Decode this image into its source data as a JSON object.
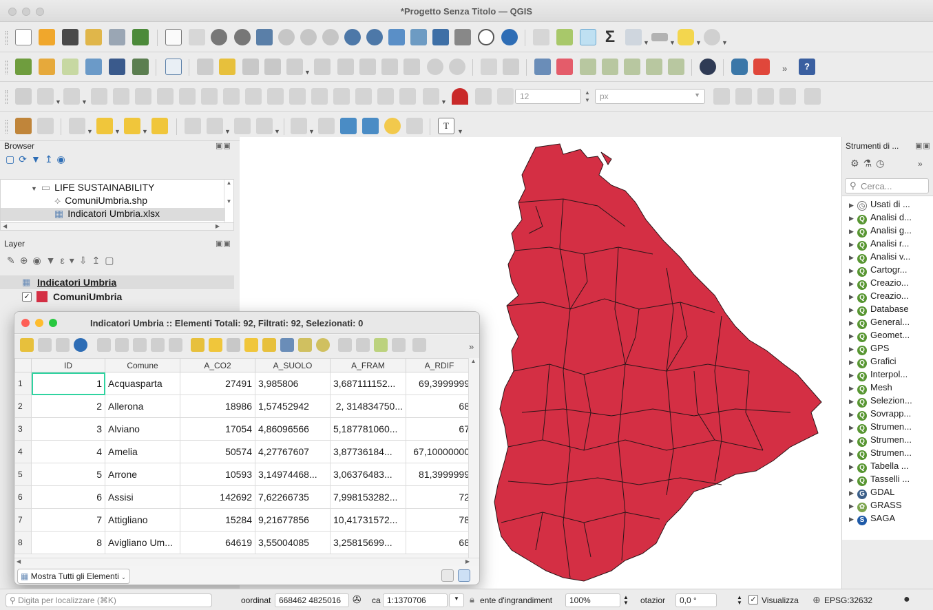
{
  "window": {
    "title": "*Progetto Senza Titolo — QGIS"
  },
  "browser": {
    "header": "Browser",
    "items": [
      {
        "label": "LIFE SUSTAINABILITY"
      },
      {
        "label": "ComuniUmbria.shp"
      },
      {
        "label": "Indicatori Umbria.xlsx"
      }
    ]
  },
  "layers": {
    "header": "Layer",
    "items": [
      {
        "label": "Indicatori Umbria",
        "checked": false
      },
      {
        "label": "ComuniUmbria",
        "checked": true,
        "color": "#d42f44"
      }
    ]
  },
  "processing": {
    "header": "Strumenti di ...",
    "search_placeholder": "Cerca...",
    "items": [
      {
        "label": "Usati di ...",
        "icon": "clock-icon"
      },
      {
        "label": "Analisi d...",
        "icon": "qgis-icon"
      },
      {
        "label": "Analisi g...",
        "icon": "qgis-icon"
      },
      {
        "label": "Analisi r...",
        "icon": "qgis-icon"
      },
      {
        "label": "Analisi v...",
        "icon": "qgis-icon"
      },
      {
        "label": "Cartogr...",
        "icon": "qgis-icon"
      },
      {
        "label": "Creazio...",
        "icon": "qgis-icon"
      },
      {
        "label": "Creazio...",
        "icon": "qgis-icon"
      },
      {
        "label": "Database",
        "icon": "qgis-icon"
      },
      {
        "label": "General...",
        "icon": "qgis-icon"
      },
      {
        "label": "Geomet...",
        "icon": "qgis-icon"
      },
      {
        "label": "GPS",
        "icon": "qgis-icon"
      },
      {
        "label": "Grafici",
        "icon": "qgis-icon"
      },
      {
        "label": "Interpol...",
        "icon": "qgis-icon"
      },
      {
        "label": "Mesh",
        "icon": "qgis-icon"
      },
      {
        "label": "Selezion...",
        "icon": "qgis-icon"
      },
      {
        "label": "Sovrapp...",
        "icon": "qgis-icon"
      },
      {
        "label": "Strumen...",
        "icon": "qgis-icon"
      },
      {
        "label": "Strumen...",
        "icon": "qgis-icon"
      },
      {
        "label": "Strumen...",
        "icon": "qgis-icon"
      },
      {
        "label": "Tabella ...",
        "icon": "qgis-icon"
      },
      {
        "label": "Tasselli ...",
        "icon": "qgis-icon"
      },
      {
        "label": "GDAL",
        "icon": "gdal-icon"
      },
      {
        "label": "GRASS",
        "icon": "grass-icon"
      },
      {
        "label": "SAGA",
        "icon": "saga-icon"
      }
    ]
  },
  "attribute_table": {
    "title": "Indicatori Umbria :: Elementi Totali: 92, Filtrati: 92, Selezionati: 0",
    "columns": [
      "ID",
      "Comune",
      "A_CO2",
      "A_SUOLO",
      "A_FRAM",
      "A_RDIF"
    ],
    "rows": [
      {
        "n": "1",
        "id": "1",
        "comune": "Acquasparta",
        "co2": "27491",
        "suolo": "3,985806",
        "fram": "3,687111152...",
        "rdif": "69,3999999"
      },
      {
        "n": "2",
        "id": "2",
        "comune": "Allerona",
        "co2": "18986",
        "suolo": "1,57452942",
        "fram": "2, 314834750...",
        "rdif": "68"
      },
      {
        "n": "3",
        "id": "3",
        "comune": "Alviano",
        "co2": "17054",
        "suolo": "4,86096566",
        "fram": "5,187781060...",
        "rdif": "67"
      },
      {
        "n": "4",
        "id": "4",
        "comune": "Amelia",
        "co2": "50574",
        "suolo": "4,27767607",
        "fram": "3,87736184...",
        "rdif": "67,10000000"
      },
      {
        "n": "5",
        "id": "5",
        "comune": "Arrone",
        "co2": "10593",
        "suolo": "3,14974468...",
        "fram": "3,06376483...",
        "rdif": "81,3999999"
      },
      {
        "n": "6",
        "id": "6",
        "comune": "Assisi",
        "co2": "142692",
        "suolo": "7,62266735",
        "fram": "7,998153282...",
        "rdif": "72"
      },
      {
        "n": "7",
        "id": "7",
        "comune": "Attigliano",
        "co2": "15284",
        "suolo": "9,21677856",
        "fram": "10,41731572...",
        "rdif": "78"
      },
      {
        "n": "8",
        "id": "8",
        "comune": "Avigliano Um...",
        "co2": "64619",
        "suolo": "3,55004085",
        "fram": "3,25815699...",
        "rdif": "68"
      }
    ],
    "show_all_label": "Mostra Tutti gli Elementi"
  },
  "toolbar": {
    "font_size_value": "12",
    "unit_value": "px"
  },
  "statusbar": {
    "locate_placeholder": "Digita per localizzare (⌘K)",
    "coord_label": "oordinat",
    "coord_value": "668462 4825016",
    "scale_label": "ca",
    "scale_value": "1:1370706",
    "magnifier_label": "ente d'ingrandiment",
    "magnifier_value": "100%",
    "rotation_label": "otazior",
    "rotation_value": "0,0 °",
    "render_label": "Visualizza",
    "crs_label": "EPSG:32632"
  },
  "colors": {
    "polygon_fill": "#d42f44",
    "accent": "#589632"
  }
}
